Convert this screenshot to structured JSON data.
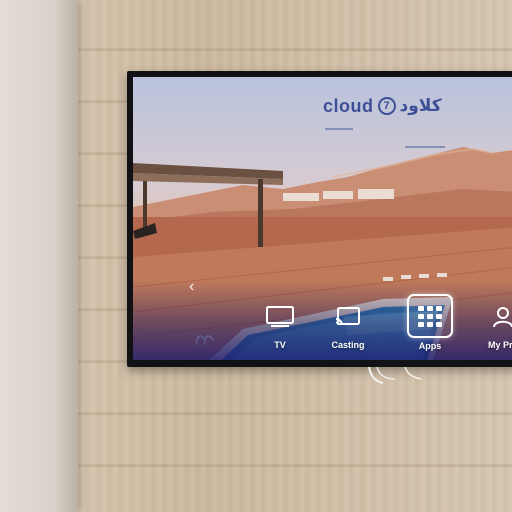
{
  "brand": {
    "name_en": "cloud",
    "mark": "7",
    "name_ar": "كلاود"
  },
  "menu": {
    "left_arrow_icon": "chevron-left-icon",
    "items": [
      {
        "label": "TV",
        "icon": "tv-icon",
        "selected": false
      },
      {
        "label": "Casting",
        "icon": "cast-icon",
        "selected": false
      },
      {
        "label": "Apps",
        "icon": "apps-grid-icon",
        "selected": true
      },
      {
        "label": "My Pro",
        "icon": "user-icon",
        "selected": false
      }
    ]
  },
  "colors": {
    "accent": "#3d4f96",
    "menu_text": "#ffffff",
    "tv_bezel": "#121216"
  }
}
